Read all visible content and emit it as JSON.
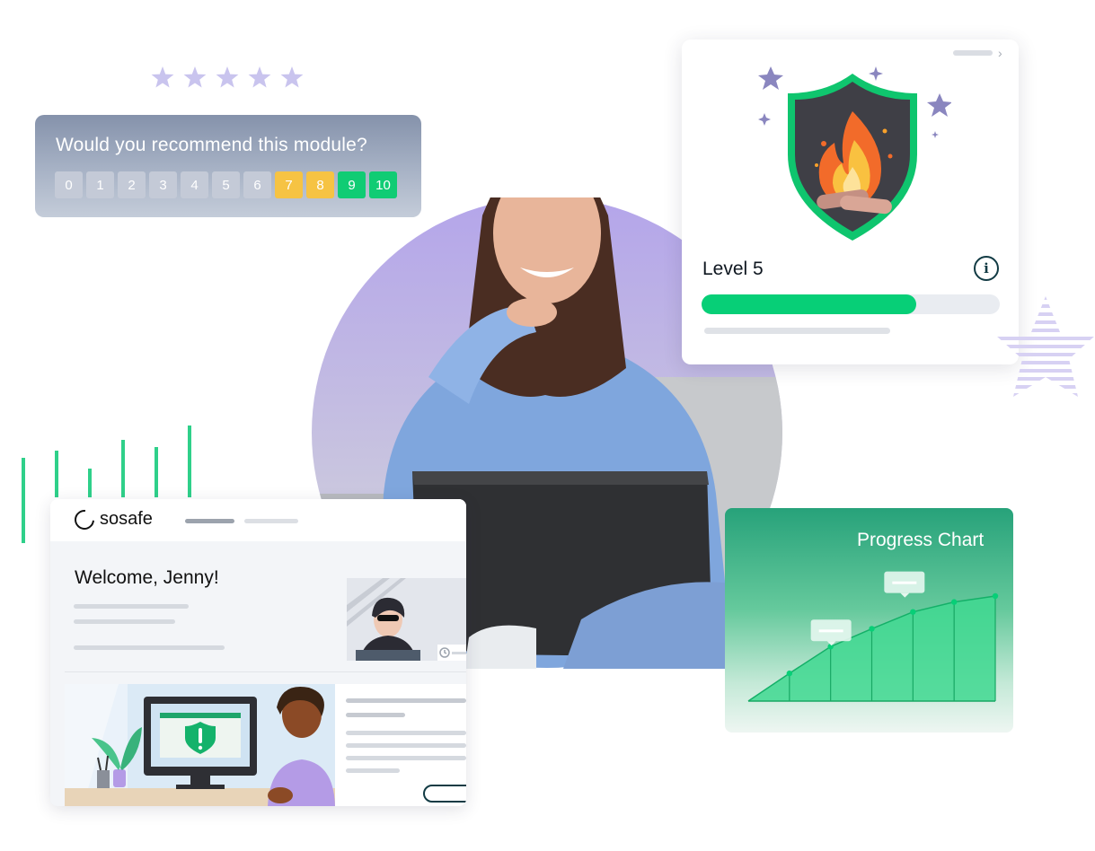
{
  "rating": {
    "stars": 5,
    "icon": "star-icon",
    "color": "#c9c4ee"
  },
  "survey": {
    "question": "Would you recommend this module?",
    "scale": [
      {
        "label": "0",
        "tone": "neutral"
      },
      {
        "label": "1",
        "tone": "neutral"
      },
      {
        "label": "2",
        "tone": "neutral"
      },
      {
        "label": "3",
        "tone": "neutral"
      },
      {
        "label": "4",
        "tone": "neutral"
      },
      {
        "label": "5",
        "tone": "neutral"
      },
      {
        "label": "6",
        "tone": "neutral"
      },
      {
        "label": "7",
        "tone": "yellow"
      },
      {
        "label": "8",
        "tone": "yellow"
      },
      {
        "label": "9",
        "tone": "green"
      },
      {
        "label": "10",
        "tone": "green"
      }
    ]
  },
  "level_card": {
    "badge_icon": "campfire-shield-icon",
    "title": "Level 5",
    "info_icon": "info-icon",
    "info_glyph": "i",
    "progress": 0.72,
    "progress_color": "#07cf77",
    "chevron_glyph": "›"
  },
  "dashboard": {
    "brand": "sosafe",
    "welcome": "Welcome, Jenny!",
    "lesson_illustration": "shield-alert-monitor-illustration"
  },
  "progress_chart": {
    "title": "Progress Chart",
    "color": "#07cf77"
  },
  "chart_data": {
    "type": "area",
    "title": "Progress Chart",
    "x": [
      0,
      1,
      2,
      3,
      4,
      5,
      6
    ],
    "values": [
      0,
      2.8,
      5.5,
      7.3,
      9.0,
      10.0,
      10.6
    ],
    "xlabel": "",
    "ylabel": "",
    "grid": false
  },
  "bar_decoration": {
    "values": [
      55,
      65,
      40,
      80,
      70,
      100
    ],
    "color": "#2fd08a"
  },
  "colors": {
    "accent_purple": "#a99ae2",
    "accent_green": "#07cf77",
    "dark_teal": "#123b44"
  }
}
